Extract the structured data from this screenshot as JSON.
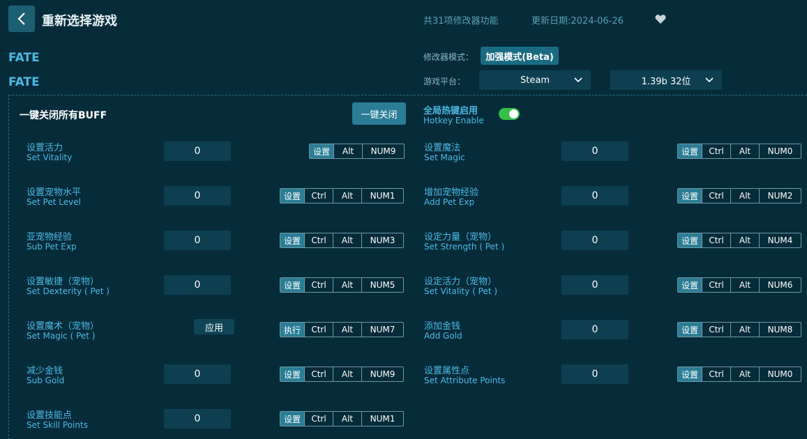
{
  "header": {
    "title": "重新选择游戏",
    "feature_count": "共31项修改器功能",
    "update_date": "更新日期:2024-06-26"
  },
  "game": {
    "name_line1": "FATE",
    "name_line2": "FATE"
  },
  "settings": {
    "mode_label": "修改器模式：",
    "mode_value": "加强模式(Beta)",
    "platform_label": "游戏平台：",
    "platform_value": "Steam",
    "version_value": "1.39b 32位"
  },
  "buff": {
    "label": "一键关闭所有BUFF",
    "button": "一键关闭"
  },
  "hotkey": {
    "cn": "全局热键启用",
    "en": "Hotkey Enable",
    "enabled": true
  },
  "options_left": [
    {
      "cn": "设置活力",
      "en": "Set Vitality",
      "value": "0",
      "action": "设置",
      "keys": [
        "Alt",
        "NUM9"
      ]
    },
    {
      "cn": "设置宠物水平",
      "en": "Set Pet Level",
      "value": "0",
      "action": "设置",
      "keys": [
        "Ctrl",
        "Alt",
        "NUM1"
      ]
    },
    {
      "cn": "亚宠物经验",
      "en": "Sub Pet Exp",
      "value": "0",
      "action": "设置",
      "keys": [
        "Ctrl",
        "Alt",
        "NUM3"
      ]
    },
    {
      "cn": "设置敏捷（宠物）",
      "en": "Set Dexterity ( Pet )",
      "value": "0",
      "action": "设置",
      "keys": [
        "Ctrl",
        "Alt",
        "NUM5"
      ]
    },
    {
      "cn": "设置魔术（宠物）",
      "en": "Set Magic ( Pet )",
      "apply": "应用",
      "action": "执行",
      "keys": [
        "Ctrl",
        "Alt",
        "NUM7"
      ]
    },
    {
      "cn": "减少金钱",
      "en": "Sub Gold",
      "value": "0",
      "action": "设置",
      "keys": [
        "Ctrl",
        "Alt",
        "NUM9"
      ]
    },
    {
      "cn": "设置技能点",
      "en": "Set Skill Points",
      "value": "0",
      "action": "设置",
      "keys": [
        "Ctrl",
        "Alt",
        "NUM1"
      ]
    }
  ],
  "options_right": [
    {
      "cn": "设置魔法",
      "en": "Set Magic",
      "value": "0",
      "action": "设置",
      "keys": [
        "Ctrl",
        "Alt",
        "NUM0"
      ]
    },
    {
      "cn": "增加宠物经验",
      "en": "Add Pet Exp",
      "value": "0",
      "action": "设置",
      "keys": [
        "Ctrl",
        "Alt",
        "NUM2"
      ]
    },
    {
      "cn": "设定力量（宠物）",
      "en": "Set Strength ( Pet )",
      "value": "0",
      "action": "设置",
      "keys": [
        "Ctrl",
        "Alt",
        "NUM4"
      ]
    },
    {
      "cn": "设定活力（宠物）",
      "en": "Set Vitality ( Pet )",
      "value": "0",
      "action": "设置",
      "keys": [
        "Ctrl",
        "Alt",
        "NUM6"
      ]
    },
    {
      "cn": "添加金钱",
      "en": "Add Gold",
      "value": "0",
      "action": "设置",
      "keys": [
        "Ctrl",
        "Alt",
        "NUM8"
      ]
    },
    {
      "cn": "设置属性点",
      "en": "Set Attribute Points",
      "value": "0",
      "action": "设置",
      "keys": [
        "Ctrl",
        "Alt",
        "NUM0"
      ]
    }
  ],
  "colors": {
    "background": "#062c3a",
    "accent": "#4cb8e3",
    "button": "#2b7d95",
    "toggle_on": "#34c046"
  }
}
